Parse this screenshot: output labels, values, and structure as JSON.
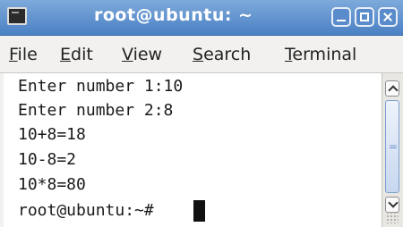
{
  "window": {
    "title": "root@ubuntu: ~",
    "icon": "terminal-app-icon",
    "controls": [
      "minimize",
      "maximize",
      "close"
    ]
  },
  "menu": {
    "items": [
      {
        "mnemonic": "F",
        "rest": "ile"
      },
      {
        "mnemonic": "E",
        "rest": "dit"
      },
      {
        "mnemonic": "V",
        "rest": "iew"
      },
      {
        "mnemonic": "S",
        "rest": "earch"
      },
      {
        "mnemonic": "T",
        "rest": "erminal"
      }
    ]
  },
  "terminal": {
    "lines": [
      "Enter number 1:10",
      "Enter number 2:8",
      "10+8=18",
      "10-8=2",
      "10*8=80",
      "root@ubuntu:~#"
    ]
  },
  "colors": {
    "titlebar": "#4a80c3",
    "terminal_bg": "#ffffff",
    "text": "#1a1a1a"
  }
}
